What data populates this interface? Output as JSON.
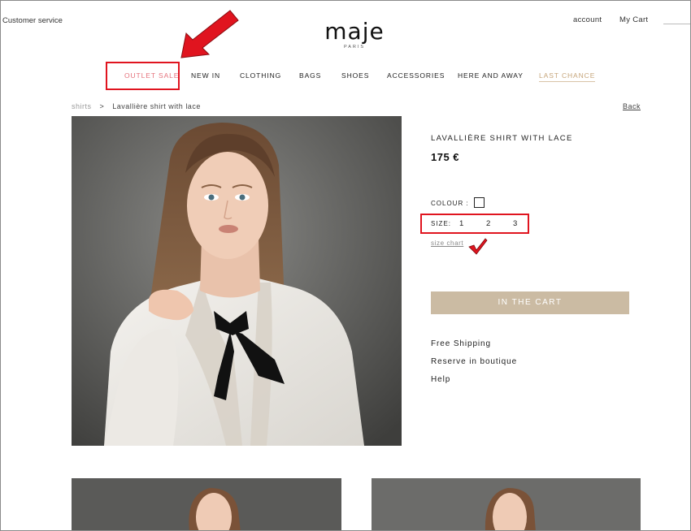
{
  "header": {
    "customer_service": "Customer service",
    "account": "account",
    "my_cart": "My Cart",
    "logo": {
      "name": "maje",
      "city": "PARIS"
    }
  },
  "nav": {
    "items": [
      {
        "label": "OUTLET SALE"
      },
      {
        "label": "NEW IN"
      },
      {
        "label": "CLOTHING"
      },
      {
        "label": "BAGS"
      },
      {
        "label": "SHOES"
      },
      {
        "label": "ACCESSORIES"
      },
      {
        "label": "HERE AND AWAY"
      },
      {
        "label": "LAST CHANCE"
      }
    ]
  },
  "breadcrumb": {
    "category": "shirts",
    "separator": ">",
    "current": "Lavallière shirt with lace",
    "back": "Back"
  },
  "product": {
    "title": "LAVALLIÈRE SHIRT WITH LACE",
    "price": "175 €",
    "colour_label": "COLOUR :",
    "size_label": "SIZE:",
    "sizes": [
      "1",
      "2",
      "3"
    ],
    "size_chart": "size chart",
    "add_to_cart": "IN THE CART",
    "links": [
      "Free Shipping",
      "Reserve in boutique",
      "Help"
    ]
  },
  "colors": {
    "sale": "#e5727c",
    "last_chance": "#c6a57a",
    "cart_button": "#cbbba3",
    "annotation_red": "#e0141f"
  }
}
